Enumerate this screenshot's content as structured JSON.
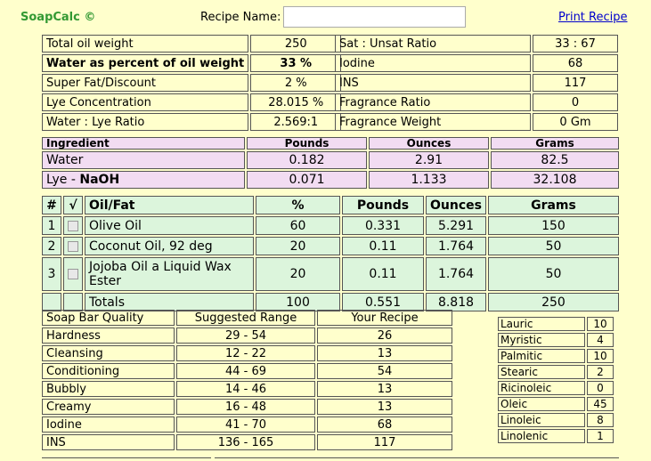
{
  "header": {
    "title": "SoapCalc ©",
    "recipe_label": "Recipe Name:",
    "recipe_value": "",
    "print_link": "Print Recipe"
  },
  "main_left": [
    {
      "label": "Total oil weight",
      "value": "250",
      "bold": false
    },
    {
      "label": "Water as percent of oil weight",
      "value": "33 %",
      "bold": true
    },
    {
      "label": "Super Fat/Discount",
      "value": "2 %",
      "bold": false
    },
    {
      "label": "Lye Concentration",
      "value": "28.015 %",
      "bold": false
    },
    {
      "label": "Water : Lye Ratio",
      "value": "2.569:1",
      "bold": false
    }
  ],
  "main_right": [
    {
      "label": "Sat : Unsat Ratio",
      "value": "33 : 67"
    },
    {
      "label": "Iodine",
      "value": "68"
    },
    {
      "label": "INS",
      "value": "117"
    },
    {
      "label": "Fragrance Ratio",
      "value": "0"
    },
    {
      "label": "Fragrance Weight",
      "value": "0 Gm"
    }
  ],
  "ingredient": {
    "headers": [
      "Ingredient",
      "Pounds",
      "Ounces",
      "Grams"
    ],
    "rows": [
      {
        "name": "Water",
        "name_suffix": "",
        "pounds": "0.182",
        "ounces": "2.91",
        "grams": "82.5"
      },
      {
        "name": "Lye - ",
        "name_suffix": "NaOH",
        "pounds": "0.071",
        "ounces": "1.133",
        "grams": "32.108"
      }
    ]
  },
  "oils": {
    "headers": [
      "#",
      "√",
      "Oil/Fat",
      "%",
      "Pounds",
      "Ounces",
      "Grams"
    ],
    "rows": [
      {
        "num": "1",
        "name": "Olive Oil",
        "pct": "60",
        "pounds": "0.331",
        "ounces": "5.291",
        "grams": "150"
      },
      {
        "num": "2",
        "name": "Coconut Oil, 92 deg",
        "pct": "20",
        "pounds": "0.11",
        "ounces": "1.764",
        "grams": "50"
      },
      {
        "num": "3",
        "name": "Jojoba Oil a Liquid Wax Ester",
        "pct": "20",
        "pounds": "0.11",
        "ounces": "1.764",
        "grams": "50"
      }
    ],
    "totals": {
      "label": "Totals",
      "pct": "100",
      "pounds": "0.551",
      "ounces": "8.818",
      "grams": "250"
    }
  },
  "quality": {
    "headers": [
      "Soap Bar Quality",
      "Suggested Range",
      "Your Recipe"
    ],
    "rows": [
      {
        "name": "Hardness",
        "range": "29 - 54",
        "value": "26"
      },
      {
        "name": "Cleansing",
        "range": "12 - 22",
        "value": "13"
      },
      {
        "name": "Conditioning",
        "range": "44 - 69",
        "value": "54"
      },
      {
        "name": "Bubbly",
        "range": "14 - 46",
        "value": "13"
      },
      {
        "name": "Creamy",
        "range": "16 - 48",
        "value": "13"
      },
      {
        "name": "Iodine",
        "range": "41 - 70",
        "value": "68"
      },
      {
        "name": "INS",
        "range": "136 - 165",
        "value": "117"
      }
    ]
  },
  "fatty_acids": [
    {
      "name": "Lauric",
      "value": "10"
    },
    {
      "name": "Myristic",
      "value": "4"
    },
    {
      "name": "Palmitic",
      "value": "10"
    },
    {
      "name": "Stearic",
      "value": "2"
    },
    {
      "name": "Ricinoleic",
      "value": "0"
    },
    {
      "name": "Oleic",
      "value": "45"
    },
    {
      "name": "Linoleic",
      "value": "8"
    },
    {
      "name": "Linolenic",
      "value": "1"
    }
  ]
}
